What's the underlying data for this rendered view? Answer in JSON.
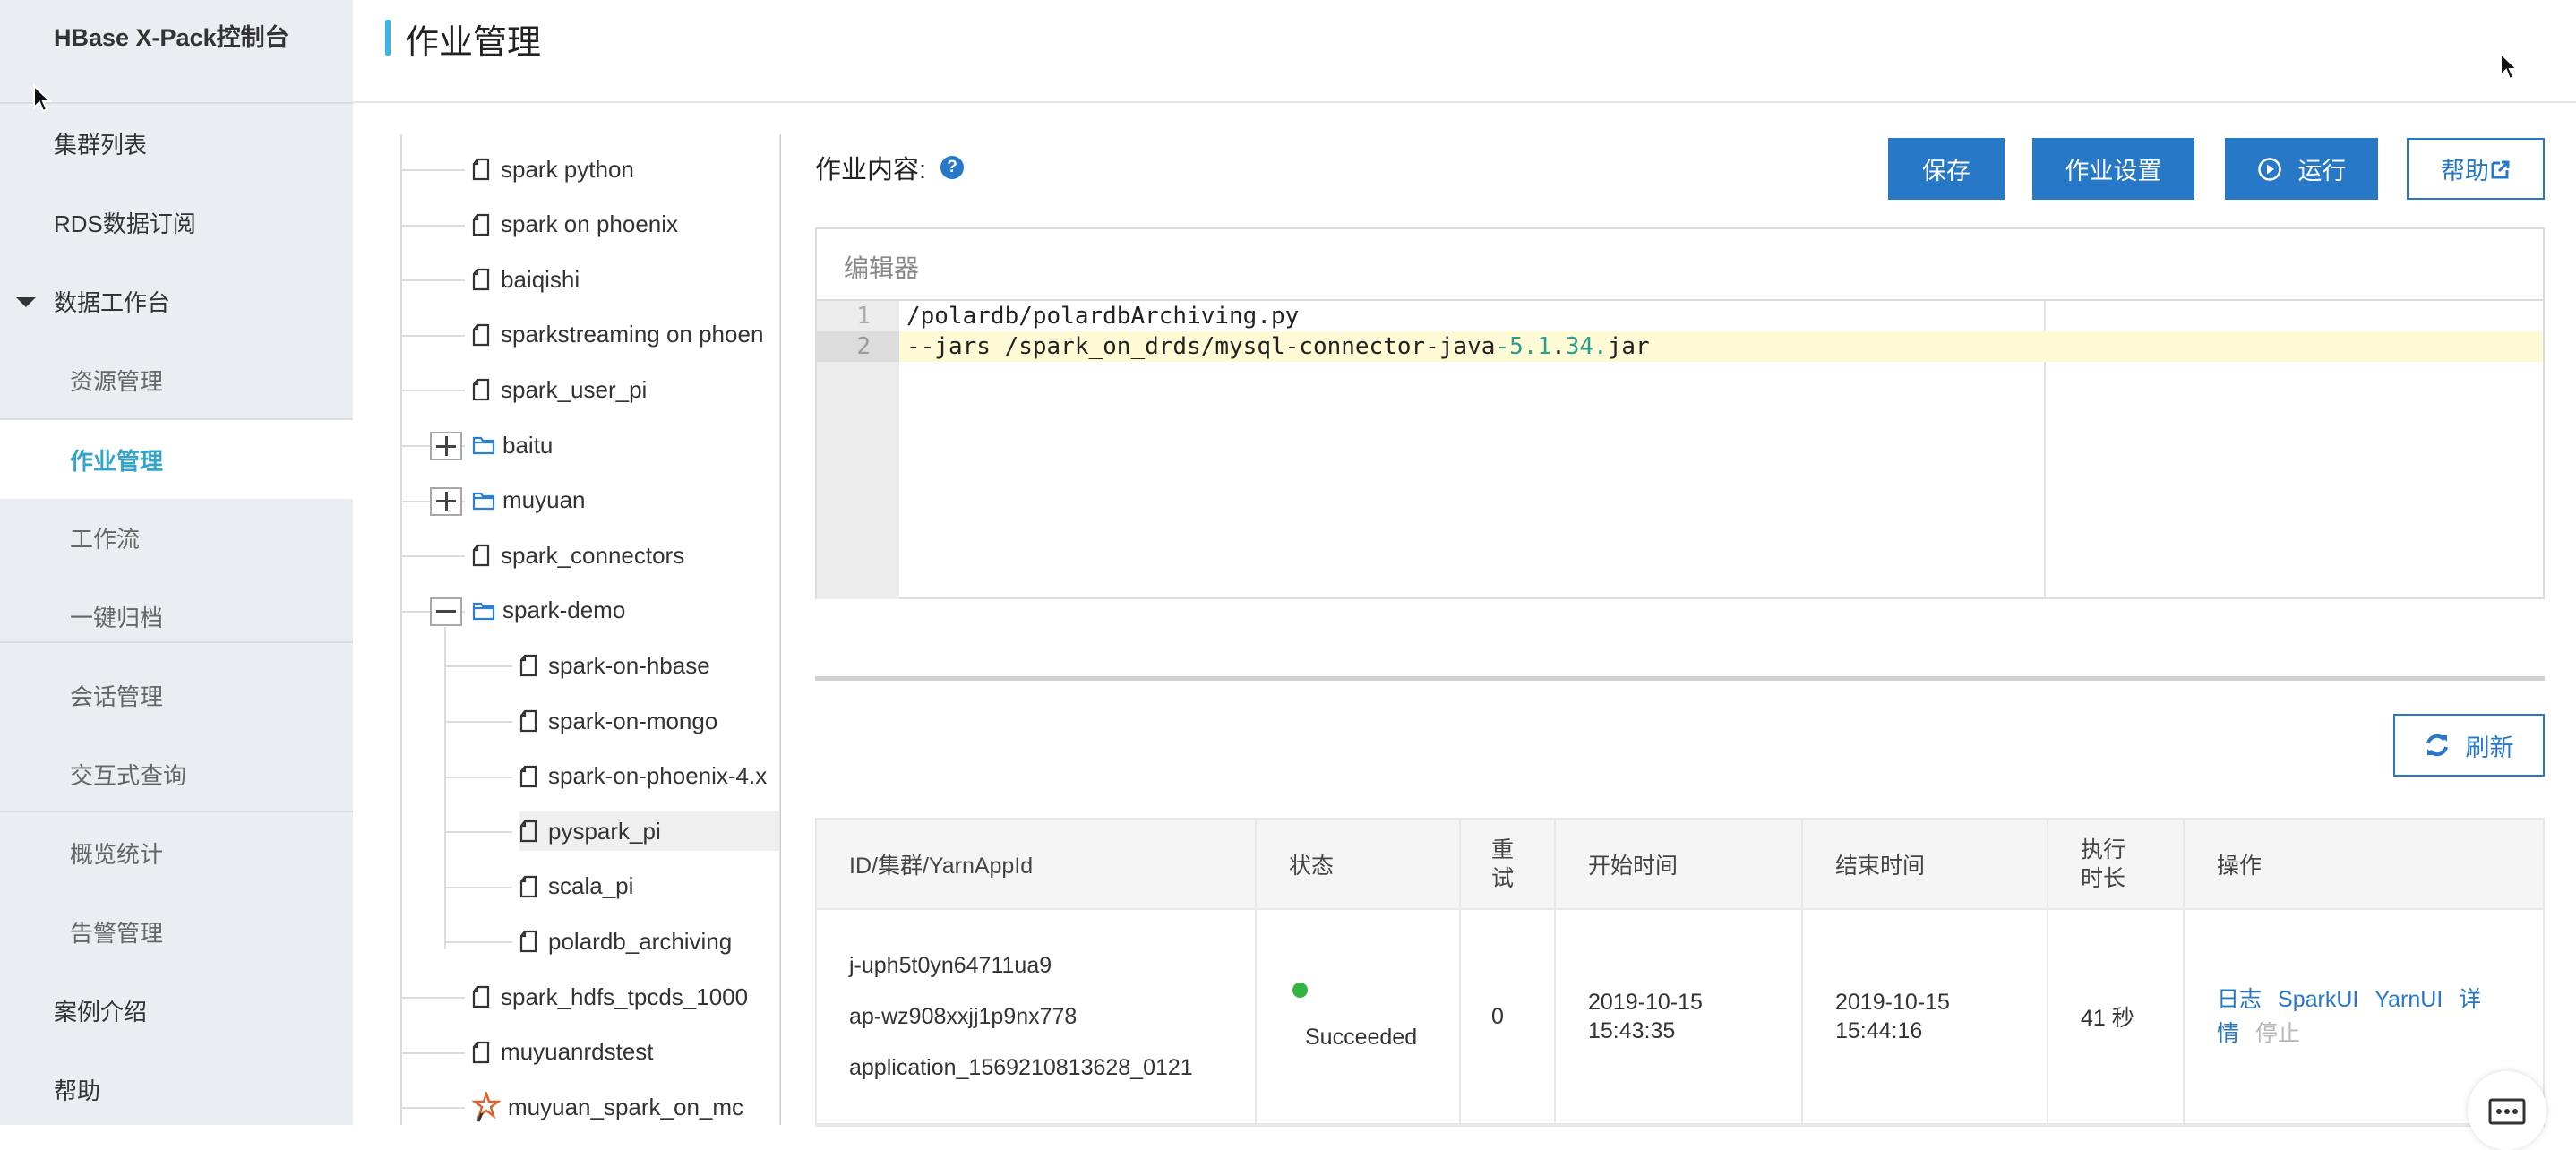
{
  "sidebar": {
    "brand": "HBase X-Pack控制台",
    "items": [
      {
        "label": "集群列表"
      },
      {
        "label": "RDS数据订阅"
      },
      {
        "label": "数据工作台"
      },
      {
        "label": "资源管理"
      },
      {
        "label": "作业管理"
      },
      {
        "label": "工作流"
      },
      {
        "label": "一键归档"
      },
      {
        "label": "会话管理"
      },
      {
        "label": "交互式查询"
      },
      {
        "label": "概览统计"
      },
      {
        "label": "告警管理"
      },
      {
        "label": "案例介绍"
      },
      {
        "label": "帮助"
      }
    ],
    "active_item": "作业管理",
    "active_color": "#34a4c9"
  },
  "header": {
    "title": "作业管理"
  },
  "tree": {
    "nodes": [
      {
        "label": "spark python",
        "type": "file",
        "level": 0
      },
      {
        "label": "spark on phoenix",
        "type": "file",
        "level": 0
      },
      {
        "label": "baiqishi",
        "type": "file",
        "level": 0
      },
      {
        "label": "sparkstreaming on phoen",
        "type": "file",
        "level": 0
      },
      {
        "label": "spark_user_pi",
        "type": "file",
        "level": 0
      },
      {
        "label": "baitu",
        "type": "folder",
        "level": 0,
        "expanded": false
      },
      {
        "label": "muyuan",
        "type": "folder",
        "level": 0,
        "expanded": false
      },
      {
        "label": "spark_connectors",
        "type": "file",
        "level": 0
      },
      {
        "label": "spark-demo",
        "type": "folder",
        "level": 0,
        "expanded": true
      },
      {
        "label": "spark-on-hbase",
        "type": "file",
        "level": 1
      },
      {
        "label": "spark-on-mongo",
        "type": "file",
        "level": 1
      },
      {
        "label": "spark-on-phoenix-4.x",
        "type": "file",
        "level": 1
      },
      {
        "label": "pyspark_pi",
        "type": "file",
        "level": 1,
        "selected": true
      },
      {
        "label": "scala_pi",
        "type": "file",
        "level": 1
      },
      {
        "label": "polardb_archiving",
        "type": "file",
        "level": 1
      },
      {
        "label": "spark_hdfs_tpcds_1000",
        "type": "file",
        "level": 0
      },
      {
        "label": "muyuanrdstest",
        "type": "file",
        "level": 0
      },
      {
        "label": "muyuan_spark_on_mc",
        "type": "spark",
        "level": 0
      }
    ]
  },
  "content": {
    "label": "作业内容:",
    "help_icon": "question-circle-icon",
    "buttons": {
      "save": "保存",
      "settings": "作业设置",
      "run": "运行",
      "help": "帮助"
    },
    "editor": {
      "title": "编辑器",
      "lines": [
        {
          "no": "1",
          "text": "/polardb/polardbArchiving.py"
        },
        {
          "no": "2",
          "pre": "--jars /spark_on_drds/mysql-connector-java",
          "n1": "-5.1",
          "mid": ".",
          "n2": "34.",
          "post": "jar"
        }
      ],
      "active_line": 2
    },
    "refresh": "刷新"
  },
  "table": {
    "headers": [
      "ID/集群/YarnAppId",
      "状态",
      "重试",
      "开始时间",
      "结束时间",
      "执行时长",
      "操作"
    ],
    "header_stacked": {
      "retry": [
        "重",
        "试"
      ],
      "duration": [
        "执行",
        "时长"
      ]
    },
    "rows": [
      {
        "ids": [
          "j-uph5t0yn64711ua9",
          "ap-wz908xxjj1p9nx778",
          "application_1569210813628_0121"
        ],
        "status": "Succeeded",
        "status_color": "#33b440",
        "retry": "0",
        "start": [
          "2019-10-15",
          "15:43:35"
        ],
        "end": [
          "2019-10-15",
          "15:44:16"
        ],
        "duration": "41 秒",
        "ops": [
          "日志",
          "SparkUI",
          "YarnUI",
          "详",
          "情",
          "停止"
        ]
      }
    ]
  },
  "colors": {
    "primary": "#2878c8",
    "sidebar_bg": "#eaedf1",
    "title_accent": "#3cb4e6",
    "code_number": "#2a9d8f",
    "active_line_bg": "#fffad6"
  }
}
